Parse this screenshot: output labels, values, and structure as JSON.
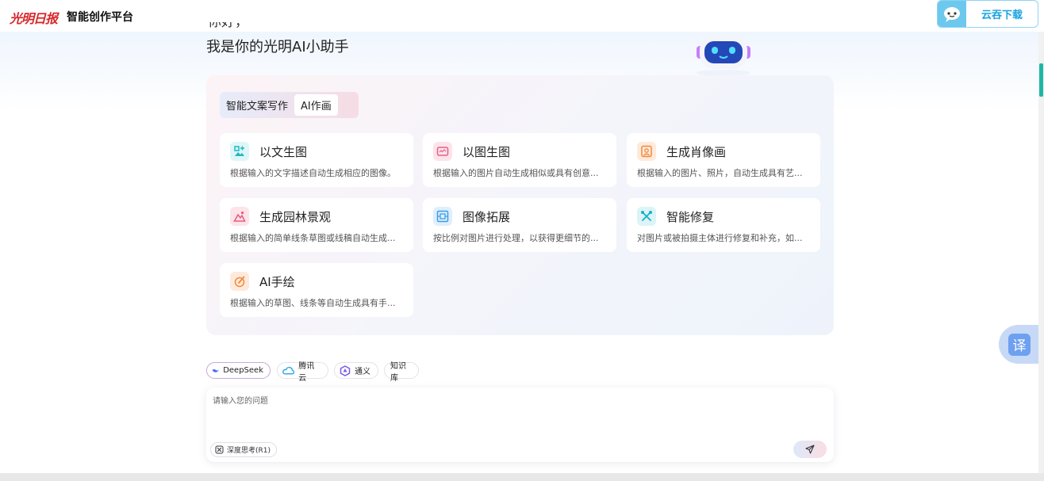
{
  "header": {
    "logo_text": "光明日报",
    "platform_title": "智能创作平台",
    "download_label": "云吞下载"
  },
  "greeting": {
    "partial_line": "你好，",
    "line": "我是你的光明AI小助手"
  },
  "tabs": [
    {
      "label": "智能文案写作",
      "active": false
    },
    {
      "label": "AI作画",
      "active": true
    }
  ],
  "tools": [
    {
      "title": "以文生图",
      "desc": "根据输入的文字描述自动生成相应的图像。",
      "icon": "text-to-image-icon",
      "color": "#1fb8c4"
    },
    {
      "title": "以图生图",
      "desc": "根据输入的图片自动生成相似或具有创意...",
      "icon": "image-to-image-icon",
      "color": "#e4608a"
    },
    {
      "title": "生成肖像画",
      "desc": "根据输入的图片、照片，自动生成具有艺...",
      "icon": "portrait-icon",
      "color": "#f08a3c"
    },
    {
      "title": "生成园林景观",
      "desc": "根据输入的简单线条草图或线稿自动生成...",
      "icon": "landscape-icon",
      "color": "#ea5a7a"
    },
    {
      "title": "图像拓展",
      "desc": "按比例对图片进行处理，以获得更细节的...",
      "icon": "expand-image-icon",
      "color": "#3a9ee8"
    },
    {
      "title": "智能修复",
      "desc": "对图片或被拍摄主体进行修复和补充，如...",
      "icon": "repair-icon",
      "color": "#17b0c8"
    },
    {
      "title": "AI手绘",
      "desc": "根据输入的草图、线条等自动生成具有手...",
      "icon": "hand-drawing-icon",
      "color": "#f08a3c"
    }
  ],
  "models": [
    {
      "label": "DeepSeek",
      "selected": true
    },
    {
      "label": "腾讯云",
      "selected": false
    },
    {
      "label": "通义",
      "selected": false
    },
    {
      "label": "知识库",
      "selected": false
    }
  ],
  "input": {
    "placeholder": "请输入您的问题",
    "deep_think_label": "深度思考(R1)"
  },
  "translate_label": "译"
}
